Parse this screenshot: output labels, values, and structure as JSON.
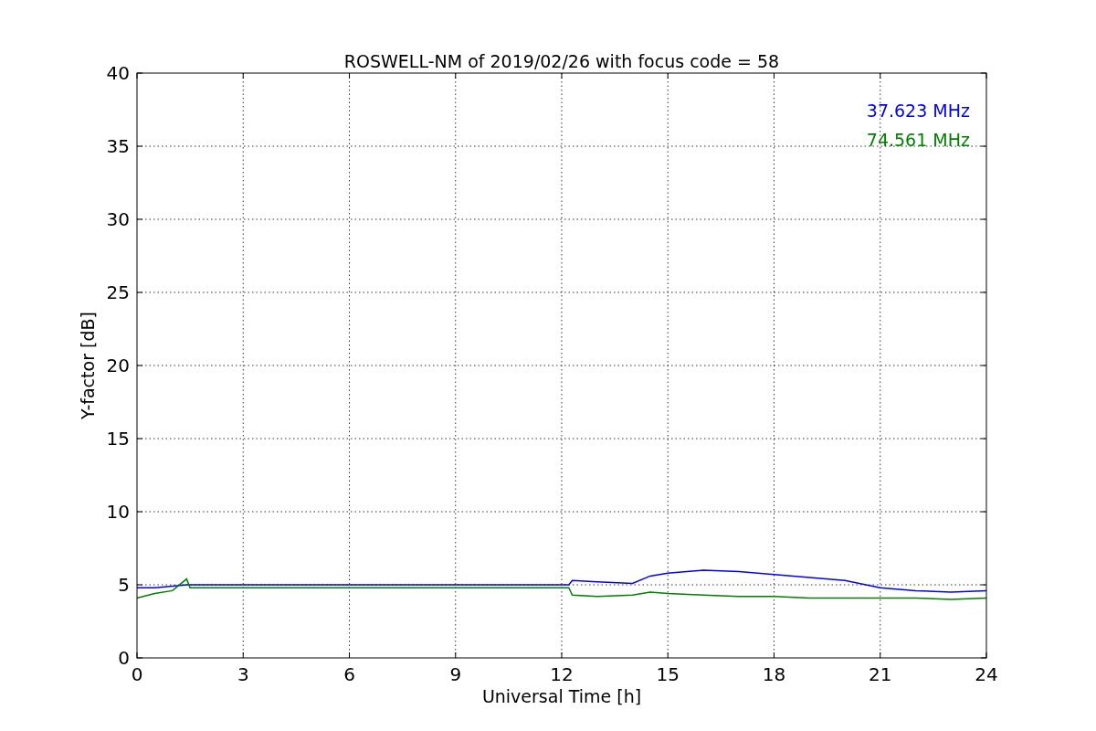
{
  "chart_data": {
    "type": "line",
    "title": "ROSWELL-NM of 2019/02/26 with focus code = 58",
    "xlabel": "Universal Time [h]",
    "ylabel": "Y-factor [dB]",
    "x": [
      0,
      0.5,
      1,
      1.4,
      1.5,
      12.2,
      12.3,
      13,
      14,
      14.5,
      15,
      16,
      17,
      18,
      19,
      20,
      21,
      22,
      23,
      24
    ],
    "series": [
      {
        "name": "37.623 MHz",
        "color": "#0000ff",
        "values": [
          4.8,
          4.8,
          4.9,
          5.0,
          5.0,
          5.0,
          5.3,
          5.2,
          5.1,
          5.6,
          5.8,
          6.0,
          5.9,
          5.7,
          5.5,
          5.3,
          4.8,
          4.6,
          4.5,
          4.6
        ]
      },
      {
        "name": "74.561 MHz",
        "color": "#008000",
        "values": [
          4.1,
          4.4,
          4.6,
          5.4,
          4.8,
          4.8,
          4.3,
          4.2,
          4.3,
          4.5,
          4.4,
          4.3,
          4.2,
          4.2,
          4.1,
          4.1,
          4.1,
          4.1,
          4.0,
          4.1
        ]
      }
    ],
    "xlim": [
      0,
      24
    ],
    "ylim": [
      0,
      40
    ],
    "xticks": [
      0,
      3,
      6,
      9,
      12,
      15,
      18,
      21,
      24
    ],
    "yticks": [
      0,
      5,
      10,
      15,
      20,
      25,
      30,
      35,
      40
    ],
    "grid": true
  }
}
